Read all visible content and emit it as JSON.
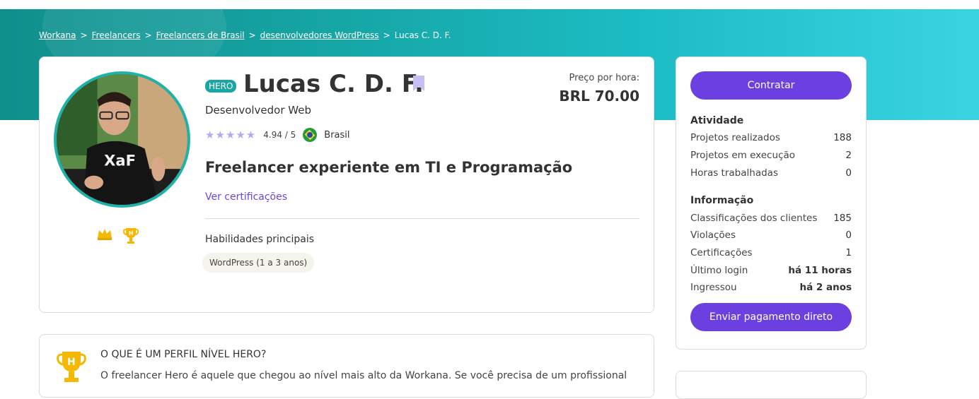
{
  "breadcrumb": {
    "items": [
      "Workana",
      "Freelancers",
      "Freelancers de Brasil",
      "desenvolvedores WordPress"
    ],
    "current": "Lucas C. D. F.",
    "separator": ">"
  },
  "profile": {
    "badge": "HERO",
    "name": "Lucas C. D. F.",
    "role": "Desenvolvedor Web",
    "rating_value": 4.94,
    "rating_text": "4.94 / 5",
    "stars": "★★★★★",
    "country": "Brasil",
    "headline": "Freelancer experiente em TI e Programação",
    "certs_link": "Ver certificações",
    "skills_label": "Habilidades principais",
    "skills": [
      "WordPress (1 a 3 anos)"
    ],
    "price_label": "Preço por hora:",
    "price_value": "BRL 70.00"
  },
  "sidebar": {
    "hire_button": "Contratar",
    "activity_title": "Atividade",
    "activity": [
      {
        "label": "Projetos realizados",
        "value": "188"
      },
      {
        "label": "Projetos em execução",
        "value": "2"
      },
      {
        "label": "Horas trabalhadas",
        "value": "0"
      }
    ],
    "info_title": "Informação",
    "info": [
      {
        "label": "Classificações dos clientes",
        "value": "185"
      },
      {
        "label": "Violações",
        "value": "0"
      },
      {
        "label": "Certificações",
        "value": "1"
      },
      {
        "label": "Último login",
        "value": "há 11 horas"
      },
      {
        "label": "Ingressou",
        "value": "há 2 anos"
      }
    ],
    "pay_button": "Enviar pagamento direto"
  },
  "hero_box": {
    "title": "O QUE É UM PERFIL NÍVEL HERO?",
    "description": "O freelancer Hero é aquele que chegou ao nível mais alto da Workana. Se você precisa de um profissional"
  },
  "colors": {
    "accent": "#6c40e0",
    "teal": "#1aa6a4",
    "star": "#b9a7f3",
    "gold": "#f5b800"
  }
}
